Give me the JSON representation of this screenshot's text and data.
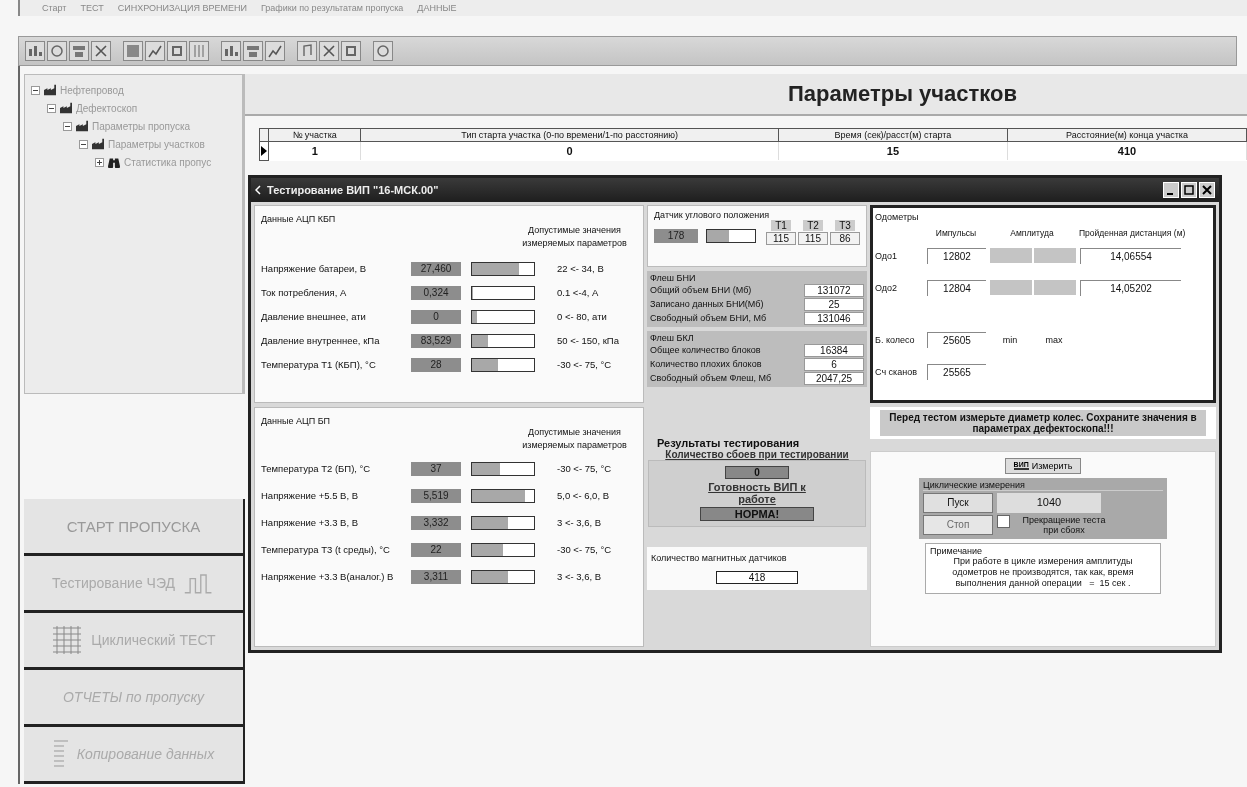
{
  "menu": [
    "Старт",
    "ТЕСТ",
    "СИНХРОНИЗАЦИЯ ВРЕМЕНИ",
    "Графики по результатам пропуска",
    "ДАННЫЕ"
  ],
  "tree": [
    {
      "label": "Нефтепровод",
      "kind": "folder",
      "expanded": true,
      "children": [
        {
          "label": "Дефектоскоп",
          "kind": "folder",
          "expanded": true,
          "children": [
            {
              "label": "Параметры пропуска",
              "kind": "folder",
              "expanded": true,
              "children": [
                {
                  "label": "Параметры участков",
                  "kind": "folder",
                  "expanded": true,
                  "children": [
                    {
                      "label": "Статистика пропус",
                      "kind": "binoculars",
                      "expanded": false
                    }
                  ]
                }
              ]
            }
          ]
        }
      ]
    }
  ],
  "nav_buttons": [
    {
      "label": "СТАРТ ПРОПУСКА",
      "kind": "plain"
    },
    {
      "label": "Тестирование ЧЭД",
      "kind": "chart"
    },
    {
      "label": "Циклический ТЕСТ",
      "kind": "grid"
    },
    {
      "label": "ОТЧЕТЫ по пропуску",
      "kind": "italic"
    },
    {
      "label": "Копирование данных",
      "kind": "list"
    }
  ],
  "header": {
    "title": "Параметры участков"
  },
  "table": {
    "columns": [
      "№ участка",
      "Тип старта участка (0-по времени/1-по расстоянию)",
      "Время (сек)/расст(м) старта",
      "Расстояние(м) конца участка"
    ],
    "rows": [
      {
        "cells": [
          "1",
          "0",
          "15",
          "410"
        ],
        "selected": true
      }
    ]
  },
  "dialog": {
    "title": "Тестирование ВИП \"16-МСК.00\"",
    "kbp": {
      "title": "Данные АЦП КБП",
      "limits_heading": "Допустимые значения измеряемых параметров",
      "rows": [
        {
          "label": "Напряжение батареи, В",
          "value": "27,460",
          "level": 0.75,
          "range": "22 <- 34, В"
        },
        {
          "label": "Ток потребления, А",
          "value": "0,324",
          "level": 0.02,
          "range": "0.1 <-4, А"
        },
        {
          "label": "Давление внешнее, ати",
          "value": "0",
          "level": 0.08,
          "range": "0 <- 80, ати"
        },
        {
          "label": "Давление внутреннее, кПа",
          "value": "83,529",
          "level": 0.25,
          "range": "50 <- 150, кПа"
        },
        {
          "label": "Температура Т1 (КБП), °С",
          "value": "28",
          "level": 0.42,
          "range": "-30 <- 75, °С"
        }
      ]
    },
    "bp": {
      "title": "Данные АЦП БП",
      "limits_heading": "Допустимые значения измеряемых параметров",
      "rows": [
        {
          "label": "Температура Т2 (БП), °С",
          "value": "37",
          "level": 0.45,
          "range": "-30 <- 75, °С"
        },
        {
          "label": "Напряжение +5.5 В, В",
          "value": "5,519",
          "level": 0.85,
          "range": "5,0 <- 6,0, В"
        },
        {
          "label": "Напряжение +3.3 В, В",
          "value": "3,332",
          "level": 0.58,
          "range": "3 <- 3,6, В"
        },
        {
          "label": "Температура Т3 (t среды), °С",
          "value": "22",
          "level": 0.5,
          "range": "-30 <- 75, °С"
        },
        {
          "label": "Напряжение +3.3 В(аналог.) В",
          "value": "3,311",
          "level": 0.58,
          "range": "3 <- 3,6, В"
        }
      ]
    },
    "angle": {
      "title": "Датчик углового положения",
      "value": "178",
      "level": 0.45,
      "temps": [
        {
          "label": "Т1",
          "value": "115"
        },
        {
          "label": "Т2",
          "value": "115"
        },
        {
          "label": "Т3",
          "value": "86"
        }
      ]
    },
    "flash_bni": {
      "title": "Флеш БНИ",
      "rows": [
        {
          "label": "Общий объем БНИ (Мб)",
          "value": "131072"
        },
        {
          "label": "Записано данных БНИ(Мб)",
          "value": "25"
        },
        {
          "label": "Свободный объем БНИ, Мб",
          "value": "131046"
        }
      ]
    },
    "flash_bkl": {
      "title": "Флеш БКЛ",
      "rows": [
        {
          "label": "Общее количество блоков",
          "value": "16384"
        },
        {
          "label": "Количество плохих блоков",
          "value": "6"
        },
        {
          "label": "Свободный объем Флеш, Мб",
          "value": "2047,25"
        }
      ]
    },
    "odometers": {
      "title": "Одометры",
      "columns": [
        "Импульсы",
        "Амплитуда",
        "Пройденная дистанция (м)"
      ],
      "rows": [
        {
          "label": "Одо1",
          "pulses": "12802",
          "distance": "14,06554"
        },
        {
          "label": "Одо2",
          "pulses": "12804",
          "distance": "14,05202"
        }
      ],
      "wheel": {
        "label": "Б. колесо",
        "value": "25605",
        "min": "min",
        "max": "max"
      },
      "scans": {
        "label": "Сч сканов",
        "value": "25565"
      }
    },
    "notice": "Перед тестом измерьте диаметр колес. Сохраните значения в параметрах дефектоскопа!!!",
    "results": {
      "title": "Результаты тестирования",
      "failures_label": "Количество сбоев при тестировании",
      "failures": "0",
      "ready_label": "Готовность ВИП к работе",
      "ready": "НОРМА!"
    },
    "magnetic": {
      "label": "Количество магнитных датчиков",
      "value": "418"
    },
    "measure": {
      "icon_label": "ВИП",
      "label": "Измерить"
    },
    "cyclic": {
      "title": "Циклические измерения",
      "start": {
        "label": "Пуск",
        "disabled": false
      },
      "value": "1040",
      "stop": {
        "label": "Стоп",
        "disabled": true
      },
      "stop_on_fail": {
        "label": "Прекращение теста при сбоях",
        "checked": false
      }
    },
    "note": {
      "title": "Примечание",
      "text": "При работе в цикле измерения амплитуды одометров не производятся, так как, время выполнения данной операции   =  15 сек ."
    }
  }
}
